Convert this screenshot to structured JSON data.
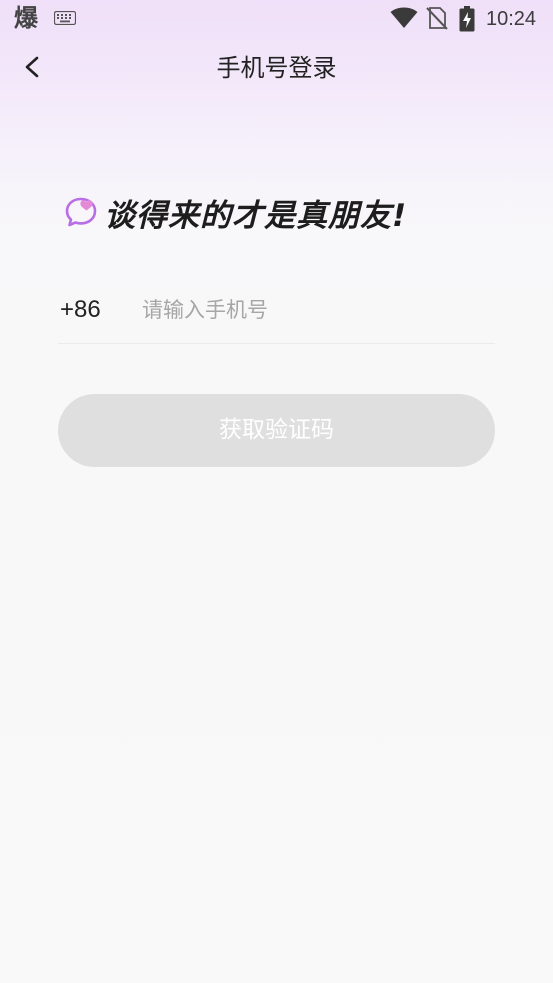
{
  "status_bar": {
    "app_icon_char": "爆",
    "time": "10:24",
    "icons": [
      "keyboard-icon",
      "wifi-icon",
      "no-sim-icon",
      "battery-charging-icon"
    ]
  },
  "header": {
    "title": "手机号登录",
    "back_icon": "chevron-left-icon"
  },
  "slogan": {
    "icon": "chat-bubble-heart-icon",
    "text": "谈得来的才是真朋友!"
  },
  "login_form": {
    "country_code": "+86",
    "phone_placeholder": "请输入手机号",
    "phone_value": "",
    "submit_label": "获取验证码"
  },
  "colors": {
    "header_gradient_top": "#efdff8",
    "background": "#f9f9f9",
    "accent_purple": "#b76ee6",
    "button_disabled": "#dfdfdf",
    "placeholder_text": "#a6a6a6"
  }
}
